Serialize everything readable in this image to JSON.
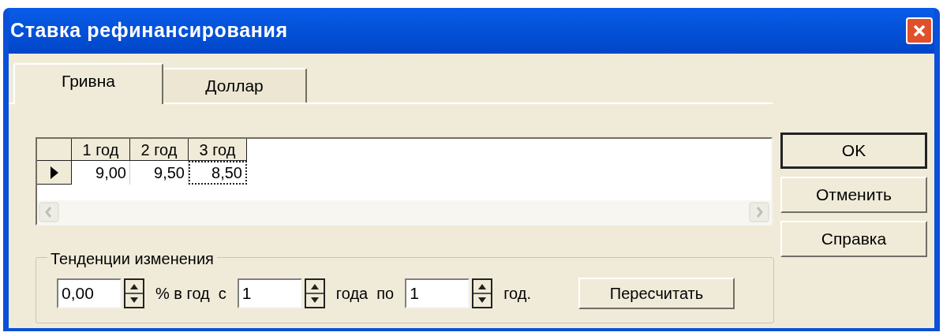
{
  "window": {
    "title": "Ставка рефинансирования"
  },
  "tabs": [
    {
      "label": "Гривна",
      "selected": true
    },
    {
      "label": "Доллар",
      "selected": false
    }
  ],
  "grid": {
    "columns": [
      "1 год",
      "2 год",
      "3 год"
    ],
    "rows": [
      {
        "current": true,
        "cells": [
          {
            "value": "9,00",
            "focused": false
          },
          {
            "value": "9,50",
            "focused": false
          },
          {
            "value": "8,50",
            "focused": true
          }
        ]
      }
    ]
  },
  "trend": {
    "title": "Тенденции изменения",
    "items": [
      {
        "kind": "spin",
        "value": "0,00"
      },
      {
        "kind": "label",
        "text": "% в год  с"
      },
      {
        "kind": "spin",
        "value": "1"
      },
      {
        "kind": "label",
        "text": "года  по"
      },
      {
        "kind": "spin",
        "value": "1"
      },
      {
        "kind": "label",
        "text": "год."
      }
    ],
    "button": "Пересчитать"
  },
  "buttons": [
    {
      "label": "OK",
      "default": true
    },
    {
      "label": "Отменить",
      "default": false
    },
    {
      "label": "Справка",
      "default": false
    }
  ]
}
